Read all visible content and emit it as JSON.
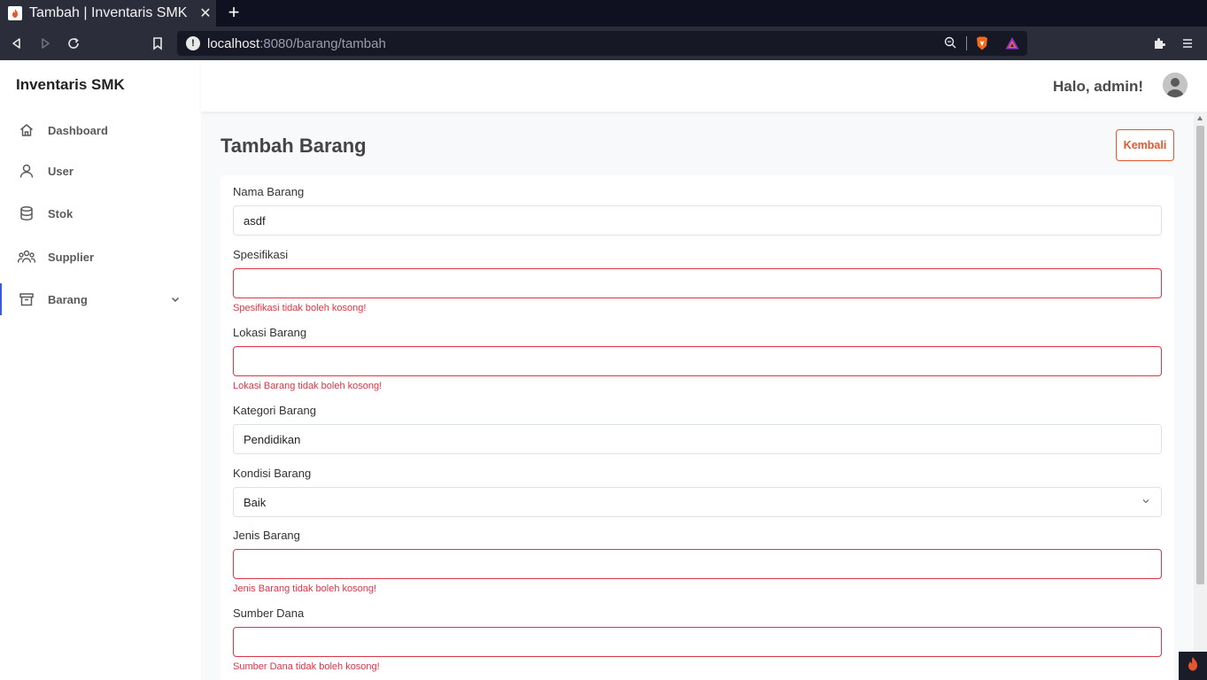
{
  "browser": {
    "tab_title": "Tambah | Inventaris SMK",
    "url_host": "localhost",
    "url_rest": ":8080/barang/tambah"
  },
  "app": {
    "brand": "Inventaris SMK",
    "greeting": "Halo, admin!",
    "accent_color": "#e4572e",
    "error_color": "#dc3545"
  },
  "sidebar": {
    "items": [
      {
        "label": "Dashboard",
        "icon": "home-icon"
      },
      {
        "label": "User",
        "icon": "user-icon"
      },
      {
        "label": "Stok",
        "icon": "database-icon"
      },
      {
        "label": "Supplier",
        "icon": "users-icon"
      },
      {
        "label": "Barang",
        "icon": "archive-icon",
        "active": true
      }
    ]
  },
  "page": {
    "title": "Tambah Barang",
    "back_label": "Kembali"
  },
  "form": {
    "fields": [
      {
        "label": "Nama Barang",
        "value": "asdf",
        "error": ""
      },
      {
        "label": "Spesifikasi",
        "value": "",
        "error": "Spesifikasi tidak boleh kosong!"
      },
      {
        "label": "Lokasi Barang",
        "value": "",
        "error": "Lokasi Barang tidak boleh kosong!"
      },
      {
        "label": "Kategori Barang",
        "value": "Pendidikan",
        "error": ""
      },
      {
        "label": "Kondisi Barang",
        "value": "Baik",
        "error": ""
      },
      {
        "label": "Jenis Barang",
        "value": "",
        "error": "Jenis Barang tidak boleh kosong!"
      },
      {
        "label": "Sumber Dana",
        "value": "",
        "error": "Sumber Dana tidak boleh kosong!"
      }
    ]
  }
}
